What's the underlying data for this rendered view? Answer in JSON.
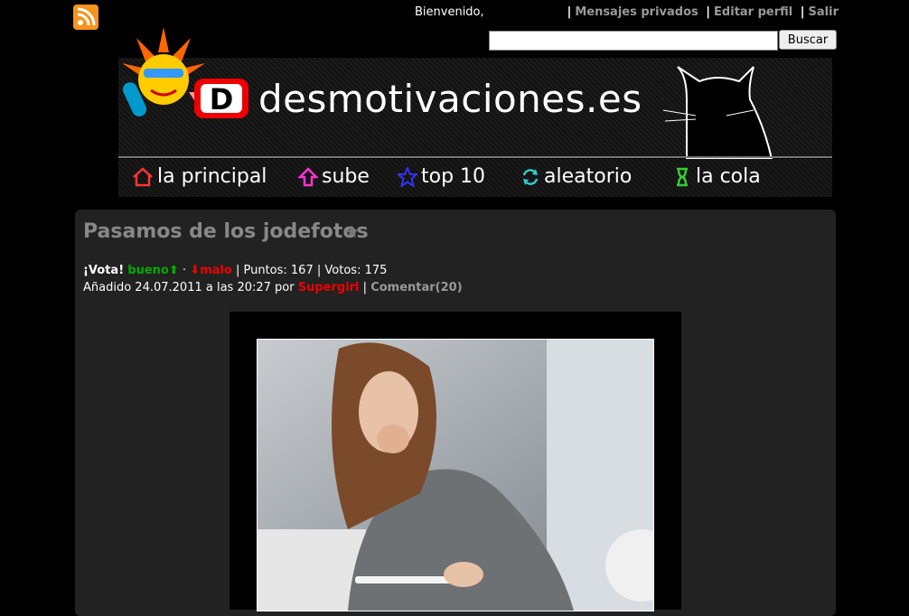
{
  "topbar": {
    "welcome": "Bienvenido,",
    "links": [
      "Mensajes privados",
      "Editar perfil",
      "Salir"
    ],
    "search_button": "Buscar"
  },
  "header": {
    "logo_text": "desmotivaciones.es",
    "logo_letter": "D"
  },
  "nav": [
    {
      "label": "la principal",
      "icon": "home-icon",
      "color": "#ff3333"
    },
    {
      "label": "sube",
      "icon": "upload-arrow-icon",
      "color": "#ff33cc"
    },
    {
      "label": "top 10",
      "icon": "star-icon",
      "color": "#3333ff"
    },
    {
      "label": "aleatorio",
      "icon": "refresh-icon",
      "color": "#33cccc"
    },
    {
      "label": "la cola",
      "icon": "hourglass-icon",
      "color": "#33cc33"
    }
  ],
  "post": {
    "title": "Pasamos de los jodefotos",
    "vote_label": "¡Vota!",
    "good_label": "bueno",
    "bad_label": "malo",
    "points": "Puntos: 167",
    "votes": "Votos: 175",
    "added_prefix": "Añadido 24.07.2011 a las 20:27 por",
    "author": "Supergirl",
    "comments": "Comentar(20)"
  }
}
